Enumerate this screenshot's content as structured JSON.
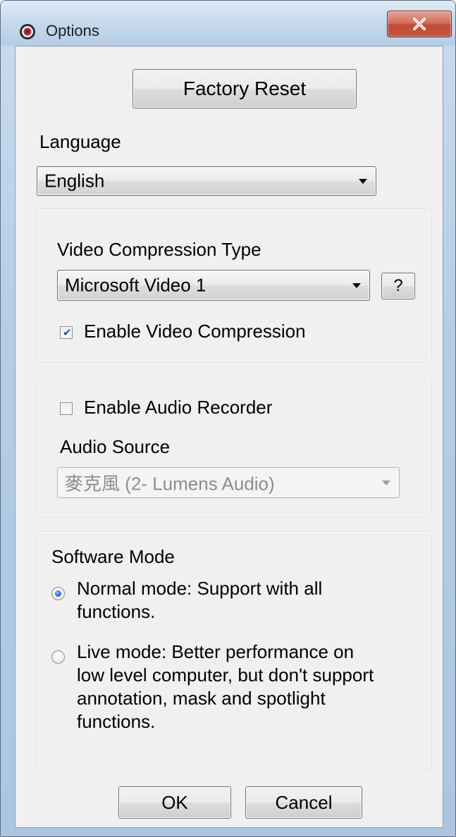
{
  "window": {
    "title": "Options",
    "close_glyph": "X"
  },
  "buttons": {
    "factory_reset": "Factory Reset",
    "ok": "OK",
    "cancel": "Cancel",
    "help": "?"
  },
  "language": {
    "label": "Language",
    "selected": "English"
  },
  "video": {
    "compression_type_label": "Video Compression Type",
    "compression_type_selected": "Microsoft Video 1",
    "enable_compression_label": "Enable Video Compression",
    "enable_compression_checked": true
  },
  "audio": {
    "enable_recorder_label": "Enable Audio Recorder",
    "enable_recorder_checked": false,
    "source_label": "Audio Source",
    "source_selected": "麥克風 (2- Lumens Audio)",
    "source_disabled": true
  },
  "software_mode": {
    "label": "Software Mode",
    "options": [
      {
        "line1": "Normal mode: Support with all",
        "line2": "functions.",
        "selected": true
      },
      {
        "line1": "Live mode: Better performance on",
        "line2": "low level computer, but don't support",
        "line3": "annotation, mask and spotlight",
        "line4": "functions.",
        "selected": false
      }
    ]
  },
  "icons": {
    "app": "app-icon",
    "close": "close-icon",
    "dropdown": "chevron-down-icon",
    "checkbox_check": "check-icon",
    "radio_dot": "radio-dot-icon"
  },
  "colors": {
    "title_bar": "#c3d7ec",
    "close_button": "#c24a35",
    "dialog_background": "#f0f0f0",
    "disabled_text": "#8d8d8d",
    "radio_selected": "#2d6fd6"
  }
}
